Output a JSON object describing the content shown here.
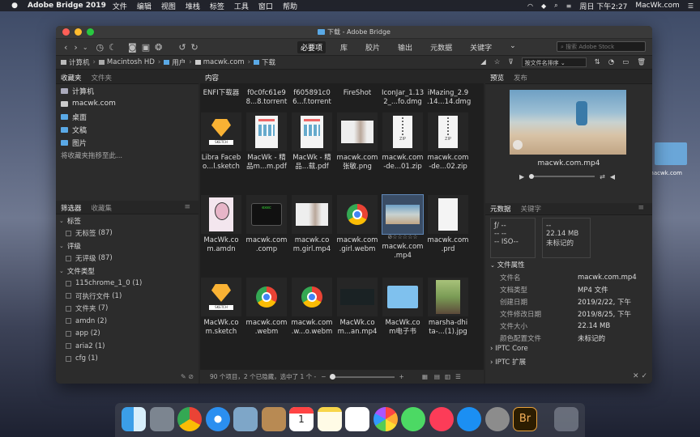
{
  "menubar": {
    "app": "Adobe Bridge 2019",
    "items": [
      "文件",
      "编辑",
      "视图",
      "堆栈",
      "标签",
      "工具",
      "窗口",
      "帮助"
    ],
    "clock": "周日 下午2:27",
    "user": "MacWk.com"
  },
  "desktop": {
    "label": "macwk.com"
  },
  "window": {
    "title": "下载 - Adobe Bridge",
    "workspaces": [
      "必要项",
      "库",
      "胶片",
      "输出",
      "元数据",
      "关键字"
    ],
    "active_workspace": "必要项",
    "search_placeholder": "搜索 Adobe Stock",
    "breadcrumb": [
      "计算机",
      "Macintosh HD",
      "用户",
      "macwk.com",
      "下载"
    ],
    "sort_label": "按文件名排序",
    "colors": {
      "accent": "#5aa9e6",
      "selection": "#3a4d66",
      "bridge": "#2c2c2c"
    }
  },
  "favorites": {
    "tabs": [
      "收藏夹",
      "文件夹"
    ],
    "items": [
      "计算机",
      "macwk.com",
      "桌面",
      "文稿",
      "图片"
    ],
    "hint": "将收藏夹拖移至此..."
  },
  "filters": {
    "tabs": [
      "筛选器",
      "收藏集"
    ],
    "rows": [
      {
        "type": "cat",
        "label": "标签"
      },
      {
        "type": "item",
        "label": "无标签",
        "count": "(87)"
      },
      {
        "type": "cat",
        "label": "评级"
      },
      {
        "type": "item",
        "label": "无评级",
        "count": "(87)"
      },
      {
        "type": "cat",
        "label": "文件类型"
      },
      {
        "type": "item",
        "label": "115chrome_1_0",
        "count": "(1)"
      },
      {
        "type": "item",
        "label": "可执行文件",
        "count": "(1)"
      },
      {
        "type": "item",
        "label": "文件夹",
        "count": "(7)"
      },
      {
        "type": "item",
        "label": "amdn",
        "count": "(2)"
      },
      {
        "type": "item",
        "label": "app",
        "count": "(2)"
      },
      {
        "type": "item",
        "label": "aria2",
        "count": "(1)"
      },
      {
        "type": "item",
        "label": "cfg",
        "count": "(1)"
      }
    ]
  },
  "content": {
    "tab": "内容",
    "status": "90 个项目，2 个已隐藏，选中了 1 个 -",
    "top_labels": [
      [
        "ENFI下载器",
        ""
      ],
      [
        "f0c0fc61e9",
        "8...8.torrent"
      ],
      [
        "f605891c0",
        "6...f.torrent"
      ],
      [
        "FireShot",
        ""
      ],
      [
        "IconJar_1.13",
        "2_...fo.dmg"
      ],
      [
        "iMazing_2.9",
        ".14...14.dmg"
      ]
    ],
    "rows": [
      [
        {
          "kind": "sketch",
          "l1": "Libra Faceb",
          "l2": "o...l.sketch"
        },
        {
          "kind": "doc",
          "l1": "MacWk - 精",
          "l2": "品m...m.pdf"
        },
        {
          "kind": "doc",
          "l1": "MacWk - 精",
          "l2": "品...载.pdf"
        },
        {
          "kind": "photo",
          "l1": "macwk.com",
          "l2": "张敏.png"
        },
        {
          "kind": "zip",
          "l1": "macwk.com",
          "l2": "-de...01.zip"
        },
        {
          "kind": "zip",
          "l1": "macwk.com",
          "l2": "-de...02.zip"
        }
      ],
      [
        {
          "kind": "art",
          "l1": "MacWk.co",
          "l2": "m.amdn"
        },
        {
          "kind": "exec",
          "l1": "macwk.com",
          "l2": ".comp"
        },
        {
          "kind": "photo",
          "l1": "macwk.co",
          "l2": "m.girl.mp4"
        },
        {
          "kind": "chrome",
          "l1": "macwk.com",
          "l2": ".girl.webm"
        },
        {
          "kind": "beach",
          "l1": "macwk.com",
          "l2": ".mp4",
          "selected": true
        },
        {
          "kind": "blank",
          "l1": "macwk.com",
          "l2": ".prd"
        }
      ],
      [
        {
          "kind": "sketch",
          "l1": "MacWk.co",
          "l2": "m.sketch"
        },
        {
          "kind": "chrome",
          "l1": "macwk.com",
          "l2": ".webm"
        },
        {
          "kind": "chrome",
          "l1": "macwk.com",
          "l2": ".w...o.webm"
        },
        {
          "kind": "dark",
          "l1": "MacWk.co",
          "l2": "m...an.mp4"
        },
        {
          "kind": "folder",
          "l1": "MacWk.co",
          "l2": "m电子书"
        },
        {
          "kind": "photo2",
          "l1": "marsha-dhi",
          "l2": "ta-...(1).jpg"
        }
      ]
    ]
  },
  "preview": {
    "tabs": [
      "预览",
      "发布"
    ],
    "filename": "macwk.com.mp4"
  },
  "metadata": {
    "tabs": [
      "元数据",
      "关键字"
    ],
    "camera": {
      "f": "ƒ/ --",
      "exp": "--",
      "a": "--",
      "b": "--",
      "iso": "ISO--",
      "c": "--"
    },
    "file_stats": {
      "size": "22.14 MB",
      "dims": "--",
      "label": "未标记的",
      "extra": "--"
    },
    "section": "文件属性",
    "rows": [
      {
        "k": "文件名",
        "v": "macwk.com.mp4"
      },
      {
        "k": "文档类型",
        "v": "MP4 文件"
      },
      {
        "k": "创建日期",
        "v": "2019/2/22, 下午"
      },
      {
        "k": "文件修改日期",
        "v": "2019/8/25, 下午"
      },
      {
        "k": "文件大小",
        "v": "22.14 MB"
      },
      {
        "k": "颜色配置文件",
        "v": "未标记的"
      }
    ],
    "sections": [
      "IPTC Core",
      "IPTC 扩展"
    ]
  },
  "dock": {
    "apps": [
      "finder",
      "launchpad",
      "chrome",
      "safari",
      "preview",
      "notes-book",
      "calendar",
      "notes",
      "reminders",
      "photos",
      "messages",
      "music",
      "appstore",
      "preferences",
      "bridge",
      "trash"
    ],
    "calendar_day": "1",
    "bridge_label": "Br"
  }
}
